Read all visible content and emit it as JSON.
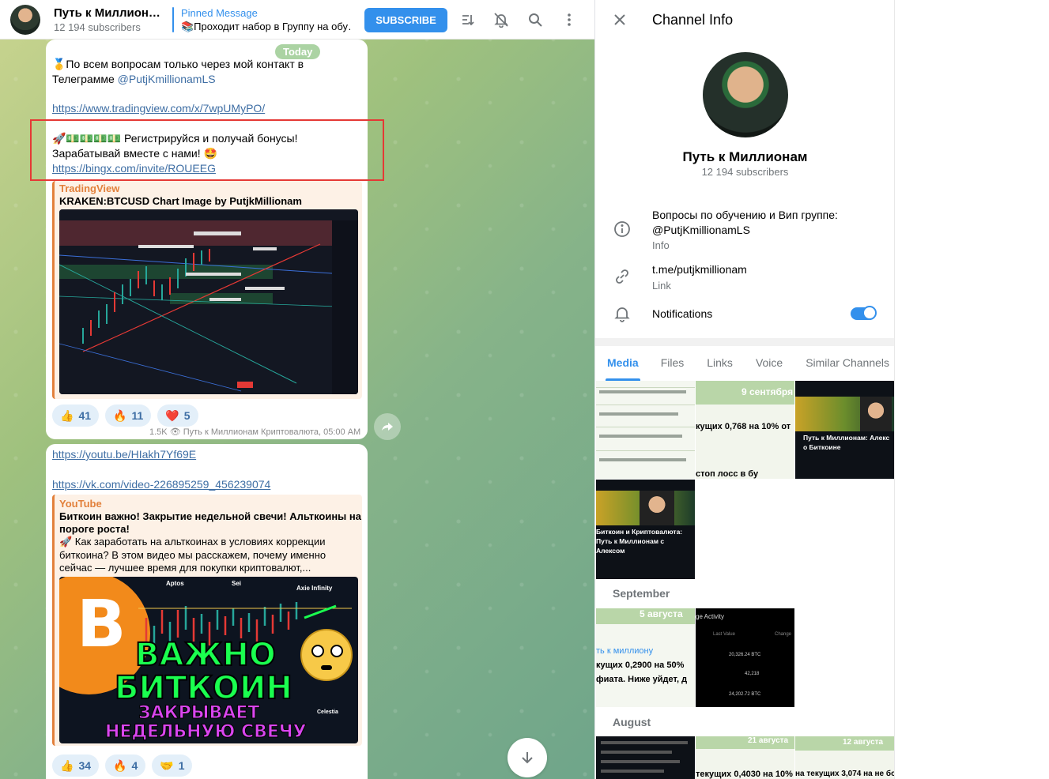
{
  "header": {
    "channel_title": "Путь к Миллион…",
    "subscribers": "12 194 subscribers",
    "pinned_title": "Pinned Message",
    "pinned_text": "📚Проходит набор в Группу на обу…",
    "subscribe_label": "SUBSCRIBE",
    "icons": [
      "filter-icon",
      "mute-bell-icon",
      "search-icon",
      "more-vertical-icon"
    ]
  },
  "chat": {
    "date_badge": "Today",
    "msg1": {
      "line1": "🥇По всем вопросам только через мой контакт в",
      "line2_prefix": "Телеграмме ",
      "mention": "@PutjKmillionamLS",
      "link1": "https://www.tradingview.com/x/7wpUMyPO/",
      "line_bonus": "🚀💵💵💵💵 Регистрируйся и получай бонусы!",
      "line_earn": "Зарабатывай вместе с нами! 🤩",
      "link2": "https://bingx.com/invite/ROUEEG",
      "preview_site": "TradingView",
      "preview_title": "KRAKEN:BTCUSD Chart Image by PutjkMillionam",
      "reactions": [
        {
          "emoji": "👍",
          "count": "41"
        },
        {
          "emoji": "🔥",
          "count": "11"
        },
        {
          "emoji": "❤️",
          "count": "5"
        }
      ],
      "views": "1.5K",
      "meta": "Путь к Миллионам Криптовалюта, 05:00 AM"
    },
    "msg2": {
      "link1": "https://youtu.be/HIakh7Yf69E",
      "link2": "https://vk.com/video-226895259_456239074",
      "preview_site": "YouTube",
      "preview_title_1": "Биткоин важно! Закрытие недельной свечи! Альткоины на",
      "preview_title_2": "пороге роста!",
      "preview_desc": "🚀 Как заработать на альткоинах в условиях коррекции биткоина? В этом видео мы расскажем, почему именно сейчас — лучшее время для покупки криптовалют,...",
      "thumb_big1": "ВАЖНО",
      "thumb_big2": "БИТКОИН",
      "thumb_small1": "ЗАКРЫВАЕТ",
      "thumb_small2": "НЕДЕЛЬНУЮ СВЕЧУ",
      "thumb_labels": [
        "Aptos",
        "Sei",
        "Axie Infinity",
        "Celestia"
      ],
      "reactions": [
        {
          "emoji": "👍",
          "count": "34"
        },
        {
          "emoji": "🔥",
          "count": "4"
        },
        {
          "emoji": "🤝",
          "count": "1"
        }
      ]
    }
  },
  "info": {
    "title": "Channel Info",
    "name": "Путь к Миллионам",
    "subscribers": "12 194 subscribers",
    "description_line1": "Вопросы по обучению и Вип группе:",
    "description_mention": "@PutjKmillionamLS",
    "description_label": "Info",
    "link": "t.me/putjkmillionam",
    "link_label": "Link",
    "notifications_label": "Notifications",
    "notifications_on": true,
    "tabs": [
      "Media",
      "Files",
      "Links",
      "Voice",
      "Similar Channels"
    ],
    "active_tab": "Media",
    "sections": [
      "September",
      "August"
    ],
    "tile_texts": {
      "sept9": "9 сентября",
      "sept9_line": "кущих 0,768 на 10% от",
      "stoploss": "стоп лосс в бу",
      "alex_title": "Путь к Миллионам: Алекс о Биткоине",
      "alex_title2": "Биткоин и Криптовалюта: Путь к Миллионам с Алексом",
      "aug5": "5 августа",
      "aug5_line1": "ть к миллиону",
      "aug5_line2": "кущих 0,2900 на 50%",
      "aug5_line3": "фиата. Ниже уйдет, д",
      "activity_title": "ge Activity",
      "activity_cols": [
        "Last Value",
        "Change"
      ],
      "activity_rows": [
        "20,326.24 BTC",
        "42,218",
        "24,202.72 BTC"
      ],
      "aug21": "21 августа",
      "aug21_line": "текущих 0,4030 на 10%",
      "aug12": "12 августа",
      "aug12_line": "на текущих 3,074 на не бол"
    }
  },
  "colors": {
    "accent": "#3390ec",
    "link": "#3e6ea4",
    "preview_accent": "#e2803b",
    "highlight_box": "#e53935"
  }
}
